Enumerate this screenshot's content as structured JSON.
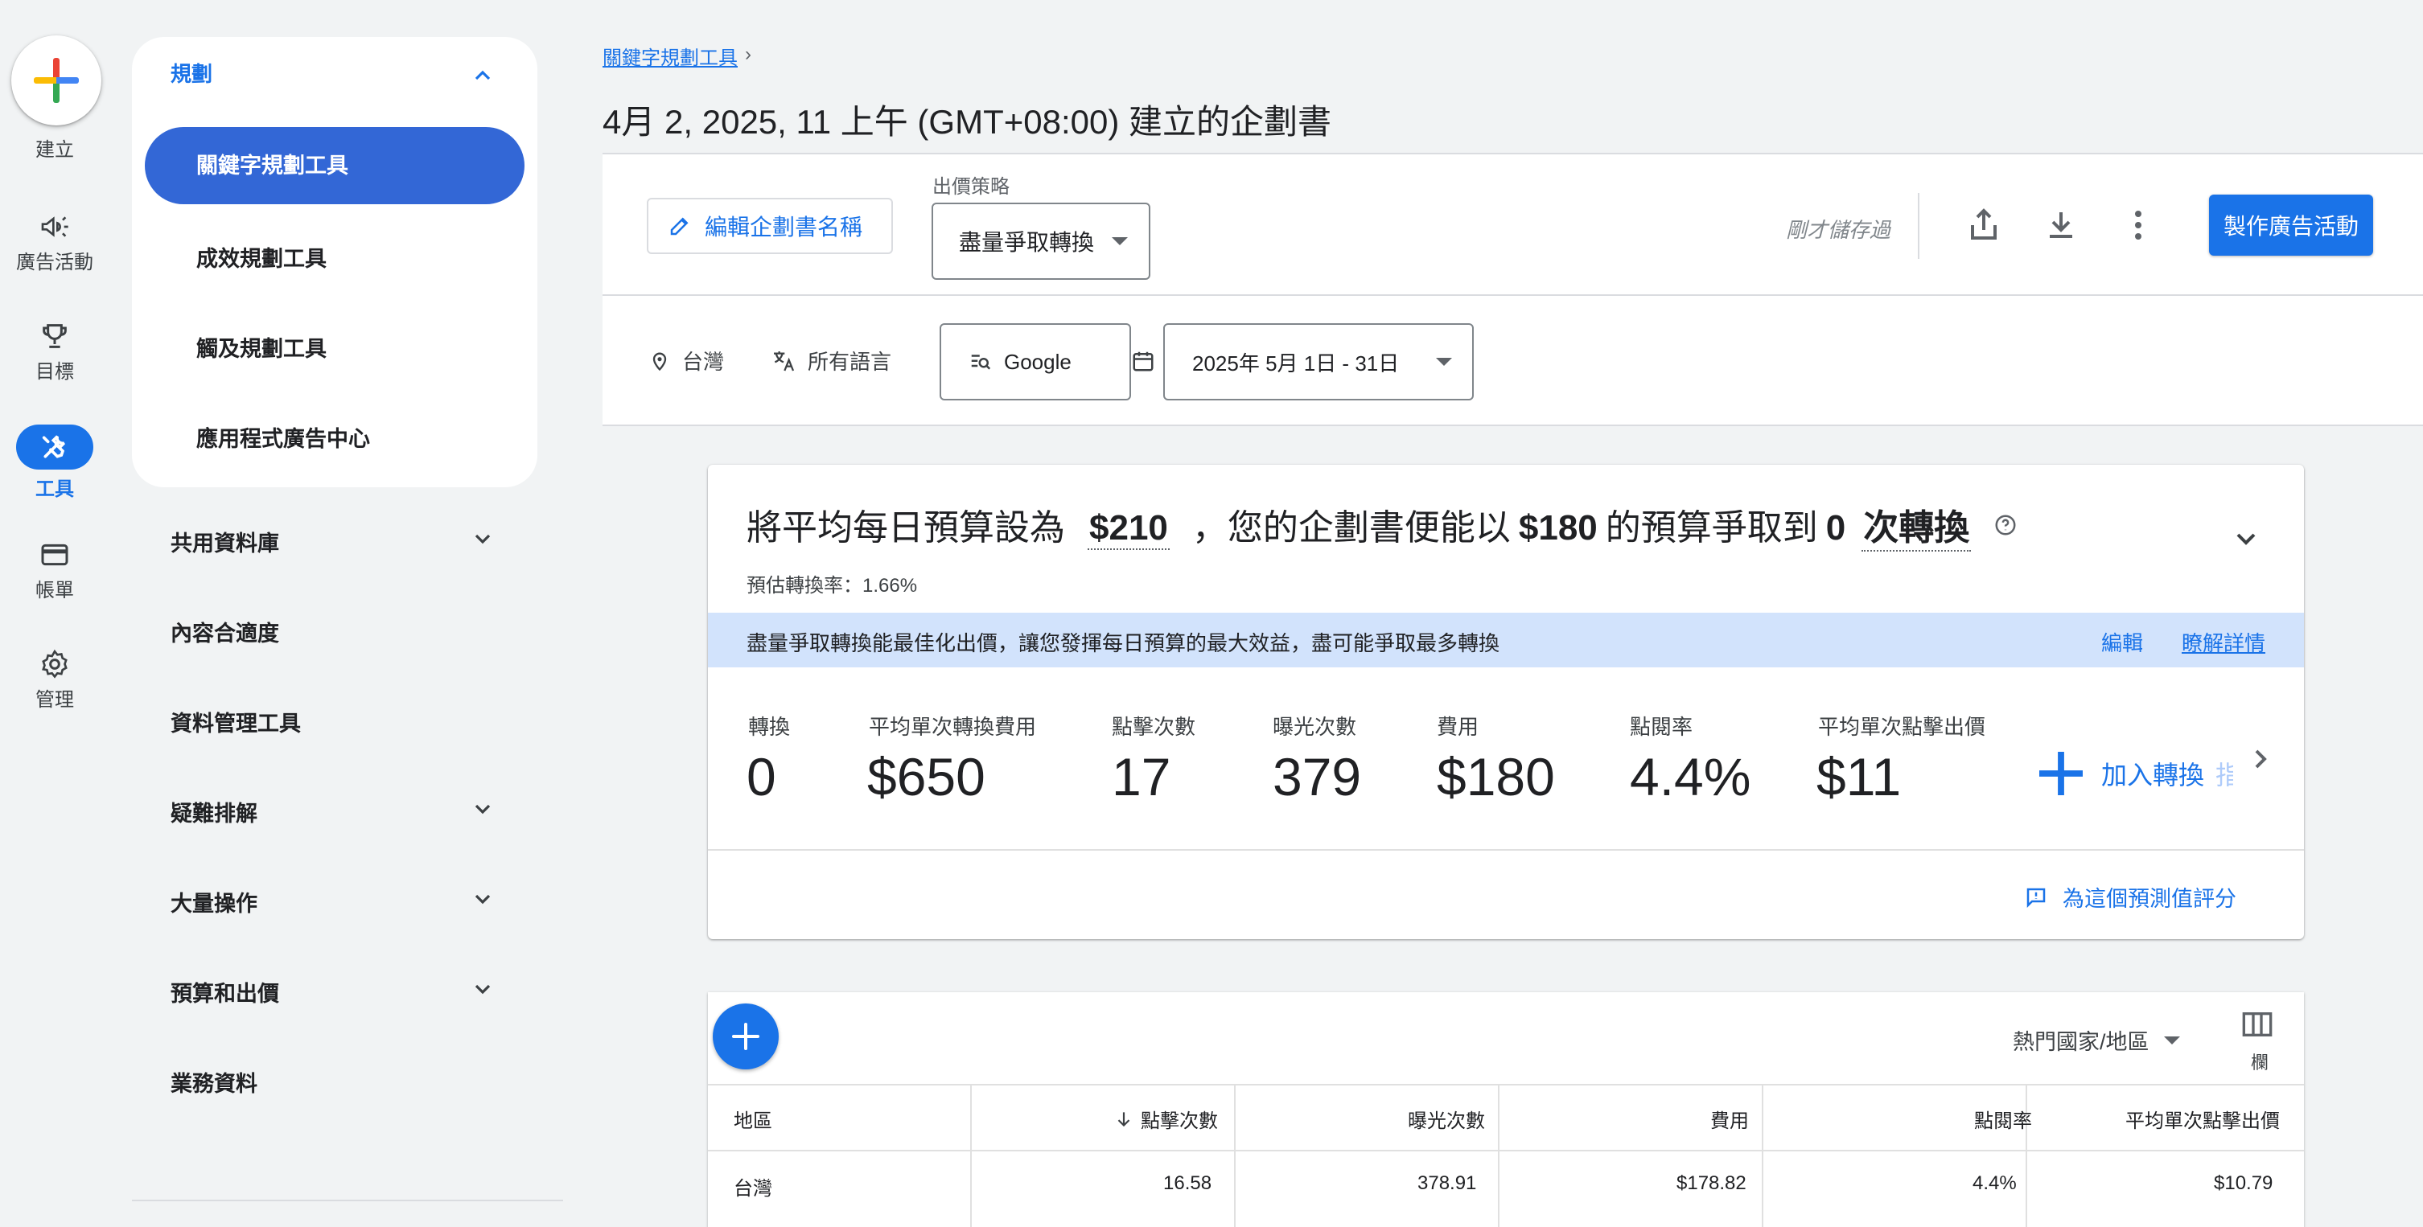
{
  "rail": {
    "create_label": "建立",
    "items": [
      {
        "label": "廣告活動",
        "icon": "megaphone-icon"
      },
      {
        "label": "目標",
        "icon": "trophy-icon"
      },
      {
        "label": "工具",
        "icon": "tools-icon"
      },
      {
        "label": "帳單",
        "icon": "credit-card-icon"
      },
      {
        "label": "管理",
        "icon": "gear-icon"
      }
    ]
  },
  "nav": {
    "section_title": "規劃",
    "sub_items": [
      "關鍵字規劃工具",
      "成效規劃工具",
      "觸及規劃工具",
      "應用程式廣告中心"
    ],
    "items": [
      "共用資料庫",
      "內容合適度",
      "資料管理工具",
      "疑難排解",
      "大量操作",
      "預算和出價",
      "業務資料"
    ]
  },
  "header": {
    "breadcrumb": "關鍵字規劃工具",
    "title": "4月 2, 2025, 11 上午 (GMT+08:00) 建立的企劃書"
  },
  "toolbar": {
    "edit_name": "編輯企劃書名稱",
    "bid_label": "出價策略",
    "bid_value": "盡量爭取轉換",
    "saved": "剛才儲存過",
    "make_campaign": "製作廣告活動"
  },
  "filters": {
    "location": "台灣",
    "language": "所有語言",
    "network": "Google",
    "date_range": "2025年 5月 1日 - 31日"
  },
  "forecast": {
    "h1": "將平均每日預算設為",
    "budget": "$210",
    "h2": "，您的企劃書便能以",
    "spend": "$180",
    "h3": "的預算爭取到",
    "conversions": "0",
    "h4": "次轉換",
    "conv_rate": "預估轉換率：1.66%",
    "info": "盡量爭取轉換能最佳化出價，讓您發揮每日預算的最大效益，盡可能爭取最多轉換",
    "edit_link": "編輯",
    "learn_link": "瞭解詳情",
    "metrics": [
      {
        "label": "轉換",
        "value": "0"
      },
      {
        "label": "平均單次轉換費用",
        "value": "$650"
      },
      {
        "label": "點擊次數",
        "value": "17"
      },
      {
        "label": "曝光次數",
        "value": "379"
      },
      {
        "label": "費用",
        "value": "$180"
      },
      {
        "label": "點閱率",
        "value": "4.4%"
      },
      {
        "label": "平均單次點擊出價",
        "value": "$11"
      }
    ],
    "add_conversion_visible": "加入轉換",
    "add_conversion_faded": "指標",
    "rate_forecast": "為這個預測值評分"
  },
  "table": {
    "country_select": "熱門國家/地區",
    "columns_label": "欄",
    "headers": [
      "地區",
      "點擊次數",
      "曝光次數",
      "費用",
      "點閱率",
      "平均單次點擊出價"
    ],
    "rows": [
      [
        "台灣",
        "16.58",
        "378.91",
        "$178.82",
        "4.4%",
        "$10.79"
      ]
    ]
  },
  "colors": {
    "accent": "#1a73e8",
    "info_band": "#d2e3fc",
    "pill": "#3367d6"
  }
}
